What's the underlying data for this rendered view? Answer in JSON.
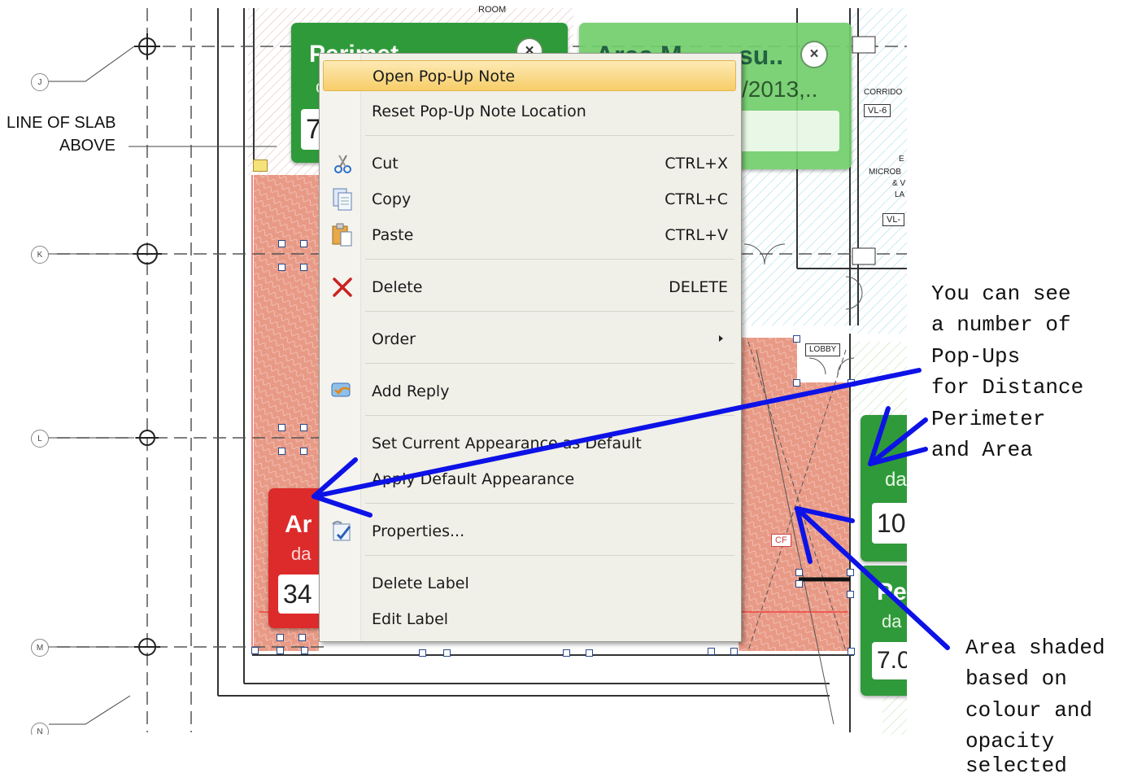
{
  "drawing": {
    "grid_labels": [
      "J",
      "K",
      "L",
      "M",
      "N"
    ],
    "slab_note_line1": "LINE OF SLAB",
    "slab_note_line2": "ABOVE",
    "room_top": "ROOM",
    "corridor_label": "CORRIDO",
    "corridor_tag": "VL-6",
    "micro_lines": [
      "E",
      "MICROB",
      "& V",
      "LA"
    ],
    "micro_tag": "VL-",
    "lobby_label": "LOBBY",
    "cf_tag": "CF"
  },
  "popups": {
    "perimeter_top": {
      "title": "Perimet",
      "sub": "c",
      "value": "7",
      "color": "#2f9a3a"
    },
    "area_top": {
      "title": "Area M",
      "title_suffix": "su..",
      "sub": "/2013,..",
      "value": "",
      "color": "#6fcf6a"
    },
    "area_red": {
      "title": "Ar",
      "sub": "da",
      "value": "34",
      "color": "#dd2b2b"
    },
    "right_upper": {
      "title": "",
      "sub": "da",
      "value": "10",
      "color": "#2f9a3a"
    },
    "right_lower": {
      "title": "Pe",
      "sub": "da",
      "value": "7.0",
      "color": "#2f9a3a"
    }
  },
  "context_menu": {
    "items": [
      {
        "label": "Open Pop-Up Note",
        "shortcut": "",
        "icon": "",
        "highlight": true
      },
      {
        "label": "Reset Pop-Up Note Location",
        "shortcut": "",
        "icon": ""
      },
      {
        "label": "Cut",
        "shortcut": "CTRL+X",
        "icon": "scissors-icon"
      },
      {
        "label": "Copy",
        "shortcut": "CTRL+C",
        "icon": "copy-icon"
      },
      {
        "label": "Paste",
        "shortcut": "CTRL+V",
        "icon": "paste-icon"
      },
      {
        "label": "Delete",
        "shortcut": "DELETE",
        "icon": "delete-x-icon"
      },
      {
        "label": "Order",
        "shortcut": "",
        "icon": "",
        "submenu": true
      },
      {
        "label": "Add Reply",
        "shortcut": "",
        "icon": "reply-icon"
      },
      {
        "label": "Set Current Appearance as Default",
        "shortcut": "",
        "icon": ""
      },
      {
        "label": "Apply Default Appearance",
        "shortcut": "",
        "icon": ""
      },
      {
        "label": "Properties...",
        "shortcut": "",
        "icon": "properties-icon"
      },
      {
        "label": "Delete Label",
        "shortcut": "",
        "icon": ""
      },
      {
        "label": "Edit Label",
        "shortcut": "",
        "icon": ""
      }
    ]
  },
  "annotations": {
    "popups_note": [
      "You can see",
      "a number of",
      "Pop-Ups",
      "for Distance",
      "Perimeter",
      "and Area"
    ],
    "area_note": [
      "Area shaded",
      "based on",
      "colour and",
      "opacity",
      "selected"
    ]
  },
  "colors": {
    "area_fill": "#e89a86",
    "arrow_blue": "#0d12e6",
    "menu_highlight": "#f7cd68"
  }
}
